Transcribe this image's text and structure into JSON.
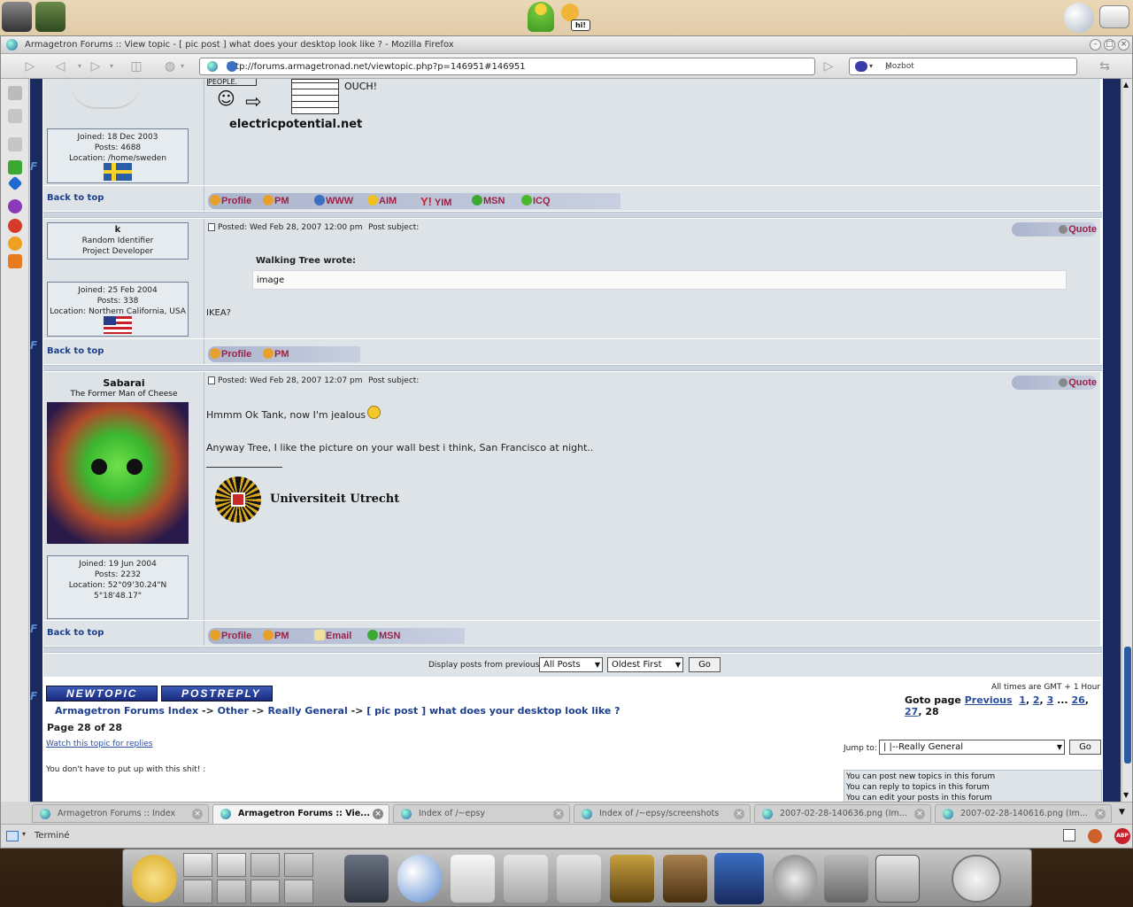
{
  "window": {
    "title": "Armagetron Forums :: View topic - [ pic post ] what does your desktop look like ? - Mozilla Firefox"
  },
  "toolbar": {
    "url": "http://forums.armagetronad.net/viewtopic.php?p=146951#146951",
    "search_engine": "Mozbot"
  },
  "top_panel": {
    "speech_bubble": "hi!"
  },
  "post1": {
    "sig_text_ouch": "OUCH!",
    "sig_text_people": "PEOPLE.",
    "sig_site": "electricpotential.net",
    "joined": "Joined: 18 Dec 2003",
    "posts": "Posts: 4688",
    "location": "Location: /home/sweden",
    "back_to_top": "Back to top",
    "buttons": [
      "Profile",
      "PM",
      "WWW",
      "AIM",
      "YIM",
      "MSN",
      "ICQ"
    ]
  },
  "post2": {
    "username": "k",
    "rank1": "Random Identifier",
    "rank2": "Project Developer",
    "joined": "Joined: 25 Feb 2004",
    "posts": "Posts: 338",
    "location": "Location: Northern California, USA",
    "posted": "Posted: Wed Feb 28, 2007 12:00 pm",
    "subject": "Post subject:",
    "quote_btn": "Quote",
    "quote_author": "Walking Tree wrote:",
    "quote_body": "image",
    "body": "IKEA?",
    "back_to_top": "Back to top",
    "buttons": [
      "Profile",
      "PM"
    ]
  },
  "post3": {
    "username": "Sabarai",
    "rank": "The Former Man of Cheese",
    "posted": "Posted: Wed Feb 28, 2007 12:07 pm",
    "subject": "Post subject:",
    "quote_btn": "Quote",
    "line1": "Hmmm Ok Tank, now I'm jealous",
    "line2": "Anyway Tree, I like the picture on your wall best i think, San Francisco at night..",
    "sig_org": "Universiteit Utrecht",
    "joined": "Joined: 19 Jun 2004",
    "posts": "Posts: 2232",
    "location1": "Location: 52°09'30.24\"N",
    "location2": "5°18'48.17\"",
    "back_to_top": "Back to top",
    "buttons": [
      "Profile",
      "PM",
      "Email",
      "MSN"
    ]
  },
  "display": {
    "label": "Display posts from previous:",
    "range": "All Posts",
    "order": "Oldest First",
    "go": "Go"
  },
  "footer": {
    "new_topic": "NEWTOPIC",
    "post_reply": "POSTREPLY",
    "timezone": "All times are GMT + 1 Hour",
    "goto_label": "Goto page",
    "goto_prev": "Previous",
    "goto_pages": [
      "1",
      "2",
      "3",
      "...",
      "26",
      "27",
      "28"
    ],
    "crumb_index": "Armagetron Forums Index",
    "crumb_other": "Other",
    "crumb_general": "Really General",
    "crumb_topic": "[ pic post ] what does your desktop look like ?",
    "arrow": "->",
    "page_of": "Page 28 of 28",
    "watch": "Watch this topic for replies",
    "sig_quote": "You don't have to put up with this shit! :",
    "jump_label": "Jump to:",
    "jump_value": "|   |--Really General",
    "jump_go": "Go",
    "perm1": "You can post new topics in this forum",
    "perm2": "You can reply to topics in this forum",
    "perm3": "You can edit your posts in this forum"
  },
  "tabs": [
    {
      "label": "Armagetron Forums :: Index"
    },
    {
      "label": "Armagetron Forums :: Vie..."
    },
    {
      "label": "Index of /~epsy"
    },
    {
      "label": "Index of /~epsy/screenshots"
    },
    {
      "label": "2007-02-28-140636.png (Im..."
    },
    {
      "label": "2007-02-28-140616.png (Im..."
    }
  ],
  "status": {
    "text": "Terminé",
    "adblock": "ABP"
  },
  "colors": {
    "forum_border": "#1a2a5e",
    "row_bg": "#dee3e7",
    "button_text": "#9a2247",
    "link": "#1d3f8c"
  }
}
